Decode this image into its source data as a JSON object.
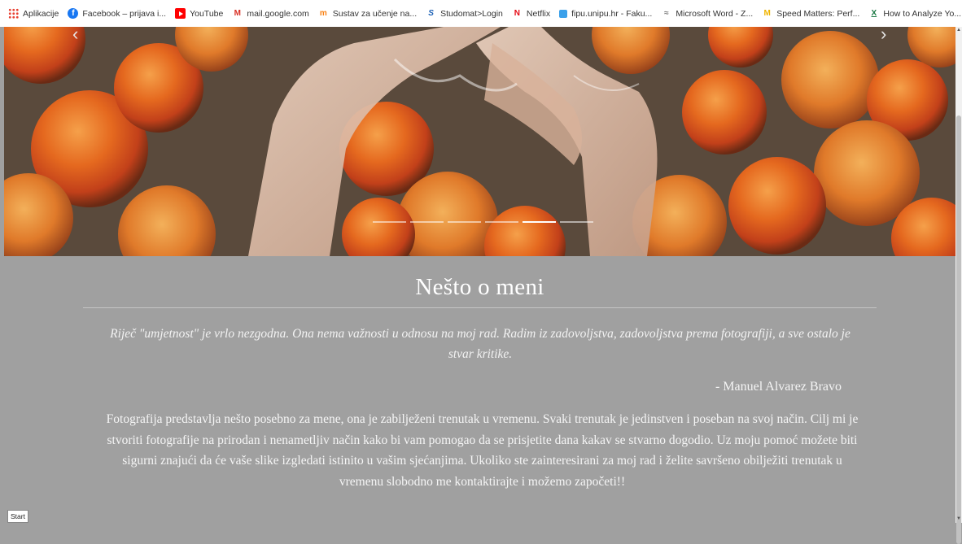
{
  "bookmarks": [
    {
      "label": "Aplikacije",
      "icon": "apps-grid-icon"
    },
    {
      "label": "Facebook – prijava i...",
      "icon": "facebook-icon"
    },
    {
      "label": "YouTube",
      "icon": "youtube-icon"
    },
    {
      "label": "mail.google.com",
      "icon": "gmail-icon"
    },
    {
      "label": "Sustav za učenje na...",
      "icon": "moodle-icon"
    },
    {
      "label": "Studomat>Login",
      "icon": "studomat-icon"
    },
    {
      "label": "Netflix",
      "icon": "netflix-icon"
    },
    {
      "label": "fipu.unipu.hr - Faku...",
      "icon": "globe-icon"
    },
    {
      "label": "Microsoft Word - Z...",
      "icon": "document-icon"
    },
    {
      "label": "Speed Matters: Perf...",
      "icon": "speed-icon"
    },
    {
      "label": "How to Analyze Yo...",
      "icon": "excel-icon"
    }
  ],
  "carousel": {
    "prev_label": "‹",
    "next_label": "›",
    "slide_count": 6,
    "active_index": 4
  },
  "about": {
    "heading": "Nešto o meni",
    "quote": "Riječ \"umjetnost\" je vrlo nezgodna. Ona nema važnosti u odnosu na moj rad. Radim iz zadovoljstva, zadovoljstva prema fotografiji, a sve ostalo je stvar kritike.",
    "author": "- Manuel Alvarez Bravo",
    "body": "Fotografija predstavlja nešto posebno za mene, ona je zabilježeni trenutak u vremenu. Svaki trenutak je jedinstven i poseban na svoj način. Cilj mi je stvoriti fotografije na prirodan i nenametljiv način kako bi vam pomogao da se prisjetite dana kakav se stvarno dogodio. Uz moju pomoć možete biti sigurni znajući da će vaše slike izgledati istinito u vašim sjećanjima. Ukoliko ste zainteresirani za moj rad i želite savršeno obilježiti trenutak u vremenu slobodno me kontaktirajte i možemo započeti!!"
  },
  "tooltip": {
    "label": "Start"
  },
  "colors": {
    "section_bg": "#a0a0a0",
    "text": "#ffffff",
    "fruit": "#e8741f"
  }
}
